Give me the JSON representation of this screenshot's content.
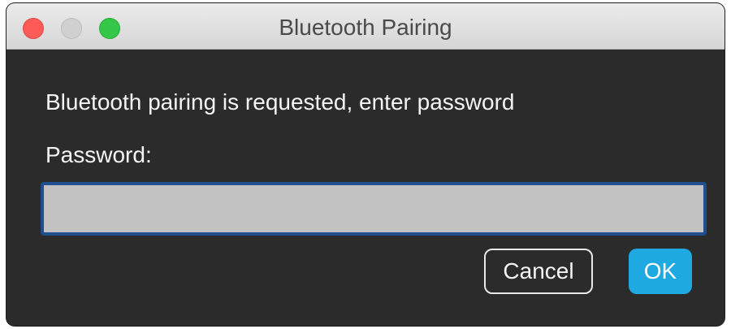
{
  "window": {
    "title": "Bluetooth Pairing"
  },
  "dialog": {
    "message": "Bluetooth pairing is requested, enter password",
    "password_label": "Password:",
    "password_value": "",
    "cancel_label": "Cancel",
    "ok_label": "OK"
  },
  "colors": {
    "background": "#2b2b2b",
    "ok_button": "#1fa9e1",
    "input_focus_border": "#1f4f8f",
    "close_light": "#fc5b57",
    "zoom_light": "#34c748"
  }
}
